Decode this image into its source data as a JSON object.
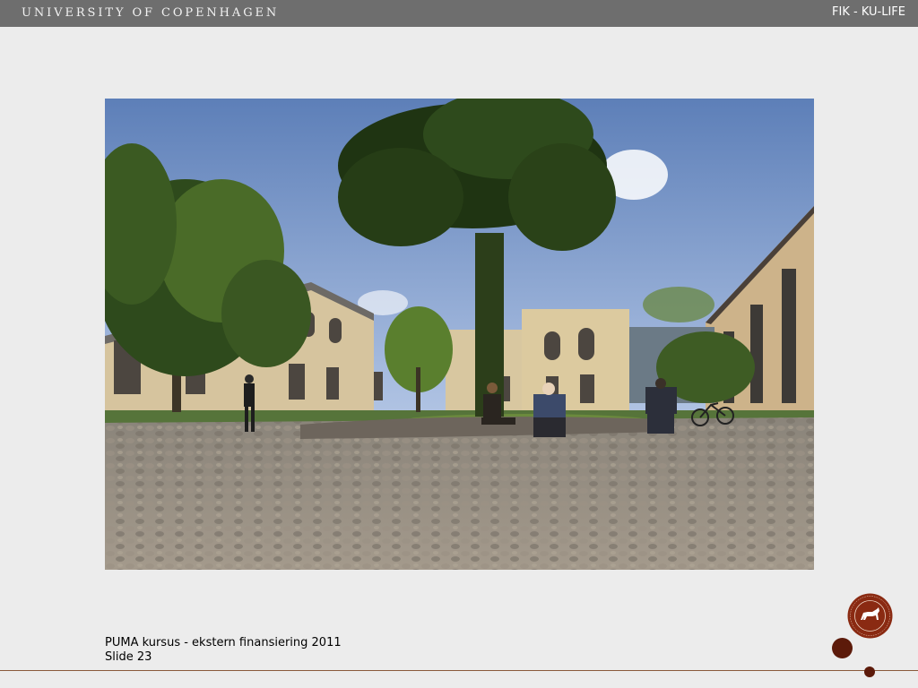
{
  "header": {
    "university": "UNIVERSITY OF COPENHAGEN",
    "org_label": "FIK - KU-LIFE"
  },
  "slide": {
    "image_subject": "campus courtyard photo"
  },
  "footer": {
    "title": "PUMA kursus - ekstern finansiering 2011",
    "slide_number": "Slide 23"
  },
  "colors": {
    "header_bg": "#6e6e6e",
    "accent": "#5c1a0a",
    "line": "#8a5a3c"
  }
}
